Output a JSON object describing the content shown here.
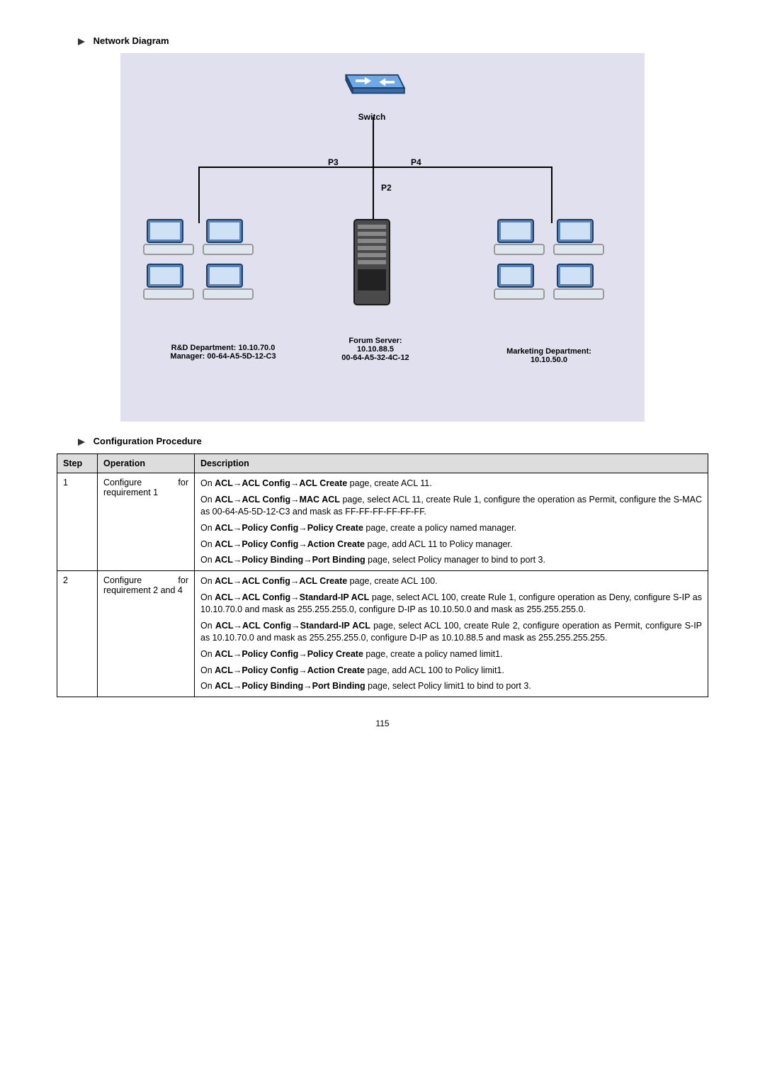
{
  "headings": {
    "network_diagram": "Network Diagram",
    "config_procedure": "Configuration Procedure"
  },
  "diagram": {
    "switch_label": "Switch",
    "p3": "P3",
    "p4": "P4",
    "p2": "P2",
    "rd_label_line1": "R&D Department: 10.10.70.0",
    "rd_label_line2": "Manager: 00-64-A5-5D-12-C3",
    "forum_line1": "Forum Server:",
    "forum_line2": "10.10.88.5",
    "forum_line3": "00-64-A5-32-4C-12",
    "mkt_line1": "Marketing Department:",
    "mkt_line2": "10.10.50.0"
  },
  "table": {
    "headers": {
      "step": "Step",
      "operation": "Operation",
      "description": "Description"
    },
    "row1": {
      "step": "1",
      "op_line": "Configure for requirement 1",
      "d1a": "On ",
      "d1b": "ACL→ACL Config→ACL Create",
      "d1c": " page, create ACL 11.",
      "d2a": "On ",
      "d2b": "ACL→ACL Config→MAC ACL",
      "d2c": " page, select ACL 11, create Rule 1, configure the operation as Permit, configure the S-MAC as 00-64-A5-5D-12-C3 and mask as FF-FF-FF-FF-FF-FF.",
      "d3a": "On ",
      "d3b": "ACL→Policy Config→Policy Create",
      "d3c": " page, create a policy named manager.",
      "d4a": "On ",
      "d4b": "ACL→Policy Config→Action Create",
      "d4c": " page, add ACL 11 to Policy manager.",
      "d5a": "On ",
      "d5b": "ACL→Policy Binding→Port Binding",
      "d5c": " page, select Policy manager to bind to port 3."
    },
    "row2": {
      "step": "2",
      "op_line": "Configure for requirement 2 and 4",
      "d1a": "On ",
      "d1b": "ACL→ACL Config→ACL Create",
      "d1c": " page, create ACL 100.",
      "d2a": "On ",
      "d2b": "ACL→ACL Config→Standard-IP ACL",
      "d2c": " page, select ACL 100, create Rule 1, configure operation as Deny, configure S-IP as 10.10.70.0 and mask as 255.255.255.0, configure D-IP as 10.10.50.0 and mask as 255.255.255.0.",
      "d3a": "On ",
      "d3b": "ACL→ACL Config→Standard-IP ACL",
      "d3c": " page, select ACL 100, create Rule 2, configure operation as Permit, configure S-IP as 10.10.70.0 and mask as 255.255.255.0, configure D-IP as 10.10.88.5 and mask as 255.255.255.255.",
      "d4a": "On ",
      "d4b": "ACL→Policy Config→Policy Create",
      "d4c": " page, create a policy named limit1.",
      "d5a": "On ",
      "d5b": "ACL→Policy Config→Action Create",
      "d5c": " page, add ACL 100 to Policy limit1.",
      "d6a": "On ",
      "d6b": "ACL→Policy Binding→Port Binding",
      "d6c": " page, select Policy limit1 to bind to port 3."
    }
  },
  "page_number": "115"
}
